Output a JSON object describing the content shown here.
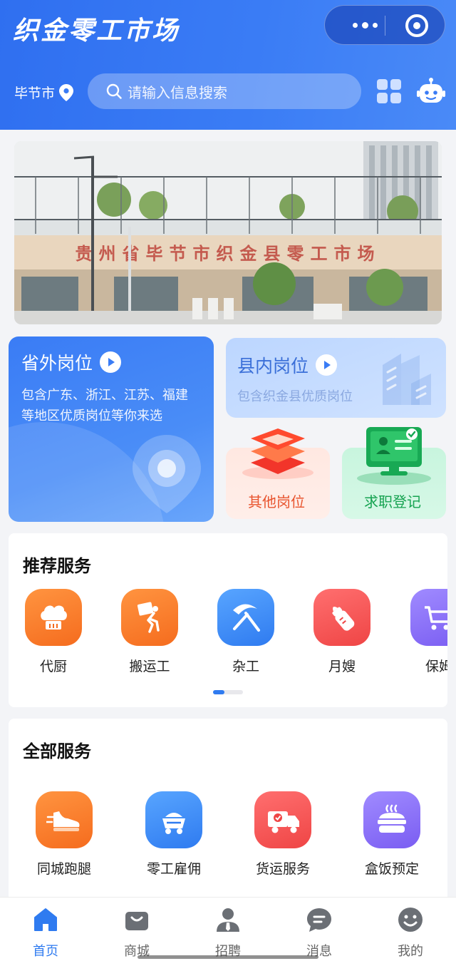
{
  "header": {
    "app_title": "织金零工市场",
    "city": "毕节市",
    "search_placeholder": "请输入信息搜索"
  },
  "banner": {
    "sign_text": "贵州省毕节市织金县零工市场"
  },
  "job_cards": {
    "out_province": {
      "title": "省外岗位",
      "desc_line1": "包含广东、浙江、江苏、福建",
      "desc_line2": "等地区优质岗位等你来选"
    },
    "in_county": {
      "title": "县内岗位",
      "desc": "包含织金县优质岗位"
    },
    "other": {
      "label": "其他岗位"
    },
    "register": {
      "label": "求职登记"
    }
  },
  "recommended": {
    "title": "推荐服务",
    "items": [
      {
        "label": "代厨",
        "icon": "chef-hat-icon",
        "color": "#f56c1e"
      },
      {
        "label": "搬运工",
        "icon": "porter-icon",
        "color": "#f56c1e"
      },
      {
        "label": "杂工",
        "icon": "pickaxe-icon",
        "color": "#2f7bf0"
      },
      {
        "label": "月嫂",
        "icon": "baby-bottle-icon",
        "color": "#ef4545"
      },
      {
        "label": "保姆",
        "icon": "cart-icon",
        "color": "#7a5df2"
      }
    ]
  },
  "all_services": {
    "title": "全部服务",
    "items": [
      {
        "label": "同城跑腿",
        "icon": "sneaker-icon",
        "color": "#f56c1e"
      },
      {
        "label": "零工雇佣",
        "icon": "mine-cart-icon",
        "color": "#2f7bf0"
      },
      {
        "label": "货运服务",
        "icon": "truck-icon",
        "color": "#ef4545"
      },
      {
        "label": "盒饭预定",
        "icon": "lunchbox-icon",
        "color": "#7a5df2"
      }
    ]
  },
  "tabbar": {
    "items": [
      {
        "label": "首页",
        "active": true
      },
      {
        "label": "商城",
        "active": false
      },
      {
        "label": "招聘",
        "active": false
      },
      {
        "label": "消息",
        "active": false
      },
      {
        "label": "我的",
        "active": false
      }
    ]
  },
  "colors": {
    "primary": "#2f7bf0",
    "header_bg": "#3a7cf5"
  }
}
